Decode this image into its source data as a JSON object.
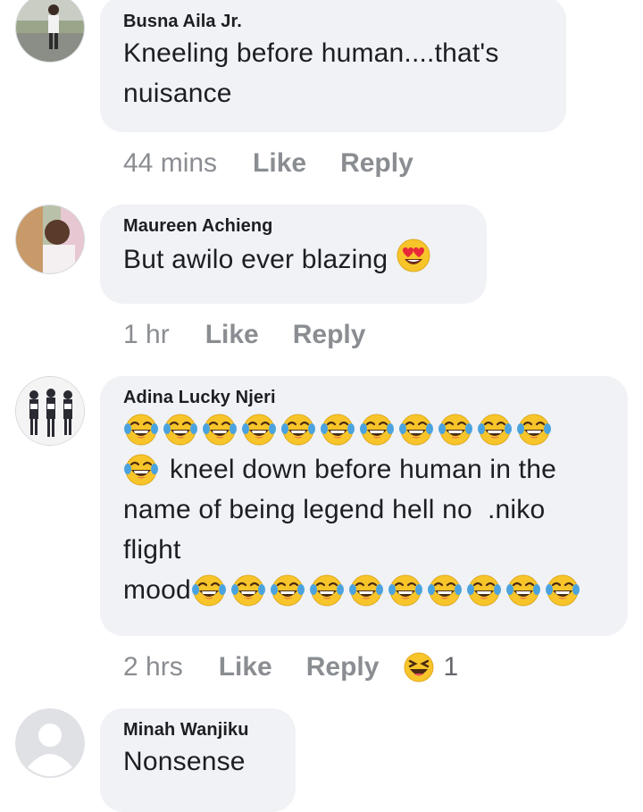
{
  "colors": {
    "bubble": "#f0f2f5",
    "meta_text": "#8a8d91",
    "emoji_face": "#f7c52a",
    "tears": "#4aa3df"
  },
  "comments": [
    {
      "author": "Busna Aila Jr.",
      "text": "Kneeling before human....that's nuisance",
      "time": "44 mins",
      "like": "Like",
      "reply": "Reply"
    },
    {
      "author": "Maureen Achieng",
      "text": "But awilo ever blazing",
      "emoji": "heart-eyes-emoji",
      "time": "1 hr",
      "like": "Like",
      "reply": "Reply"
    },
    {
      "author": "Adina Lucky Njeri",
      "line1_emoji_count": 11,
      "line2_text": "kneel down before human in the",
      "line3_text": "name of being legend hell no  .niko",
      "line4_text": "flight",
      "line5_text": "mood",
      "line5_emoji_count": 10,
      "emoji": "tears-of-joy-emoji",
      "time": "2 hrs",
      "like": "Like",
      "reply": "Reply",
      "reaction_icon": "laughing-reaction-icon",
      "reaction_count": "1"
    },
    {
      "author": "Minah Wanjiku",
      "text": "Nonsense"
    }
  ]
}
